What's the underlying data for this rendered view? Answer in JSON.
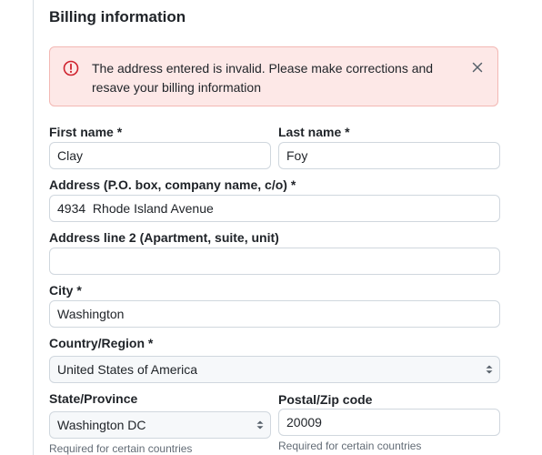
{
  "section": {
    "title": "Billing information"
  },
  "alert": {
    "message": "The address entered is invalid. Please make corrections and resave your billing information",
    "icon": "alert-circle-icon",
    "close_icon": "close-icon",
    "color": "#cf222e"
  },
  "form": {
    "first_name": {
      "label": "First name *",
      "value": "Clay"
    },
    "last_name": {
      "label": "Last name *",
      "value": "Foy"
    },
    "address": {
      "label": "Address (P.O. box, company name, c/o) *",
      "value": "4934  Rhode Island Avenue"
    },
    "address2": {
      "label": "Address line 2 (Apartment, suite, unit)",
      "value": ""
    },
    "city": {
      "label": "City *",
      "value": "Washington"
    },
    "country": {
      "label": "Country/Region *",
      "value": "United States of America"
    },
    "state": {
      "label": "State/Province",
      "value": "Washington DC",
      "hint": "Required for certain countries"
    },
    "postal": {
      "label": "Postal/Zip code",
      "value": "20009",
      "hint": "Required for certain countries"
    }
  }
}
